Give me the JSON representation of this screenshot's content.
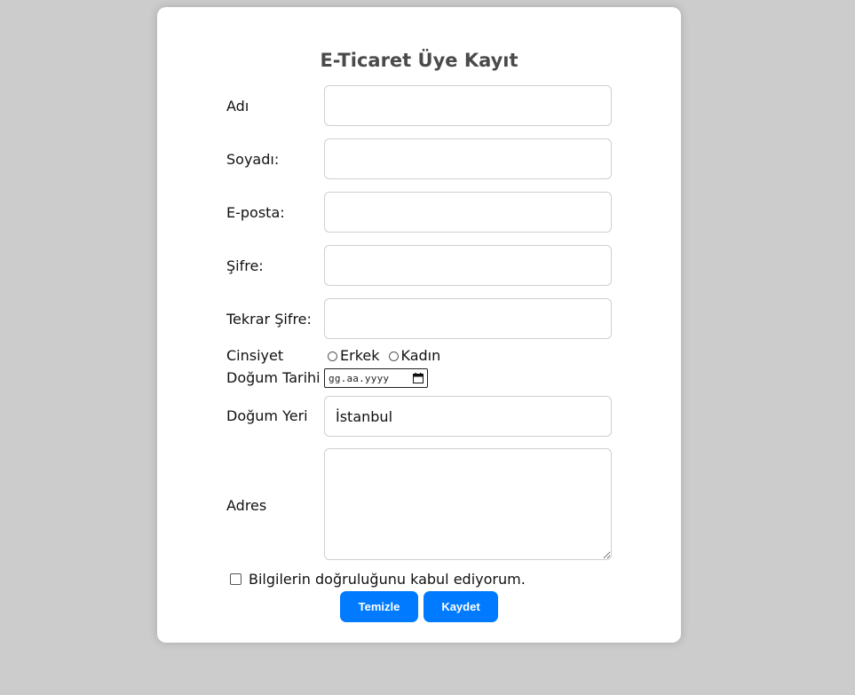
{
  "form": {
    "title": "E-Ticaret Üye Kayıt",
    "fields": {
      "first_name": {
        "label": "Adı",
        "value": ""
      },
      "last_name": {
        "label": "Soyadı:",
        "value": ""
      },
      "email": {
        "label": "E-posta:",
        "value": ""
      },
      "password": {
        "label": "Şifre:",
        "value": ""
      },
      "password_repeat": {
        "label": "Tekrar Şifre:",
        "value": ""
      },
      "gender": {
        "label": "Cinsiyet",
        "options": [
          "Erkek",
          "Kadın"
        ],
        "selected": null
      },
      "birth_date": {
        "label": "Doğum Tarihi",
        "placeholder": "gg.aa.yyyy"
      },
      "birth_place": {
        "label": "Doğum Yeri",
        "value": "İstanbul"
      },
      "address": {
        "label": "Adres",
        "value": ""
      }
    },
    "agreement": {
      "label": "Bilgilerin doğruluğunu kabul ediyorum.",
      "checked": false
    },
    "buttons": {
      "clear": "Temizle",
      "save": "Kaydet"
    }
  },
  "colors": {
    "page_background": "#cccccc",
    "card_background": "#ffffff",
    "button_primary": "#007bff",
    "title_text": "#4a4a4a"
  },
  "icons": {
    "date_picker": "calendar-icon"
  }
}
